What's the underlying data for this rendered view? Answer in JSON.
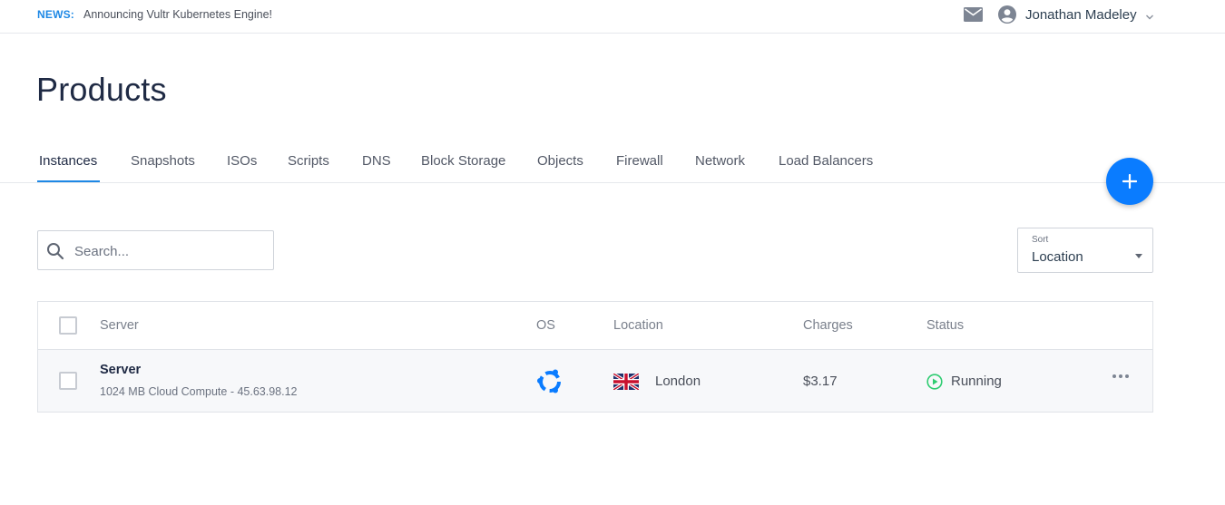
{
  "news": {
    "label": "NEWS:",
    "text": "Announcing Vultr Kubernetes Engine!"
  },
  "user": {
    "name": "Jonathan Madeley",
    "icons": [
      "mail-icon",
      "account-circle-icon",
      "chevron-down-icon"
    ]
  },
  "page": {
    "title": "Products"
  },
  "tabs": [
    {
      "label": "Instances",
      "active": true
    },
    {
      "label": "Snapshots"
    },
    {
      "label": "ISOs"
    },
    {
      "label": "Scripts"
    },
    {
      "label": "DNS"
    },
    {
      "label": "Block Storage"
    },
    {
      "label": "Objects"
    },
    {
      "label": "Firewall"
    },
    {
      "label": "Network"
    },
    {
      "label": "Load Balancers"
    }
  ],
  "fab": {
    "icon": "plus-icon"
  },
  "search": {
    "placeholder": "Search..."
  },
  "sort": {
    "label": "Sort",
    "value": "Location"
  },
  "table": {
    "columns": [
      "Server",
      "OS",
      "Location",
      "Charges",
      "Status"
    ],
    "rows": [
      {
        "name": "Server",
        "subtitle": "1024 MB Cloud Compute - 45.63.98.12",
        "os_icon": "ubuntu-icon",
        "location": "London",
        "location_flag": "uk-flag-icon",
        "charges": "$3.17",
        "status": "Running"
      }
    ]
  },
  "colors": {
    "accent": "#1e88e5",
    "fab": "#0a7cff",
    "running": "#2ecc71",
    "ubuntu_icon": "#0a7cff"
  }
}
